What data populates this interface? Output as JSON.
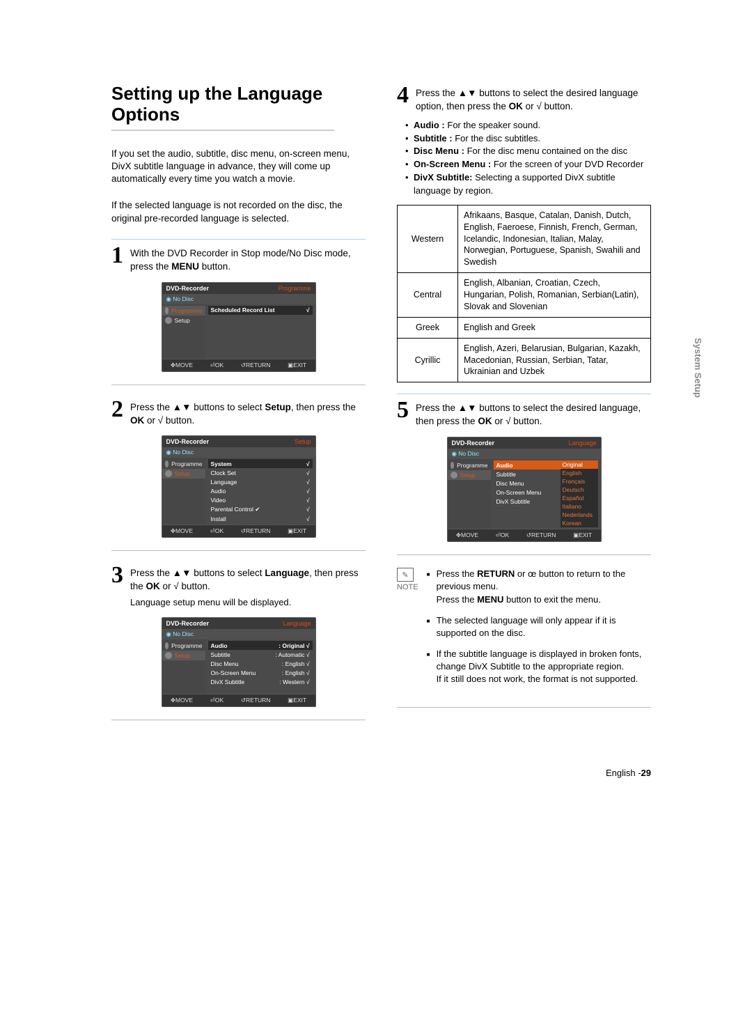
{
  "heading": "Setting up the Language Options",
  "intro1": "If you set the audio, subtitle, disc menu, on-screen menu, DivX subtitle language in advance, they will come up automatically every time you watch a movie.",
  "intro2": "If the selected language is not recorded on the disc, the original pre-recorded language is selected.",
  "step1": {
    "n": "1",
    "text": "With the DVD Recorder in Stop mode/No Disc mode, press the ",
    "b": "MENU",
    "tail": " button."
  },
  "step2": {
    "n": "2",
    "text": "Press the ▲▼ buttons to select ",
    "b": "Setup",
    "mid": ", then press the ",
    "b2": "OK",
    "tail": " or √ button."
  },
  "step3": {
    "n": "3",
    "text": "Press the ▲▼ buttons to select ",
    "b": "Language",
    "mid": ", then press the ",
    "b2": "OK",
    "tail": " or √ button.",
    "sub": "Language setup menu will be displayed."
  },
  "step4": {
    "n": "4",
    "text": "Press the ▲▼ buttons to select the desired language option, then press the ",
    "b": "OK",
    "tail": " or √ button."
  },
  "step4_bullets": [
    {
      "t": "Audio :",
      "d": " For the speaker sound."
    },
    {
      "t": "Subtitle :",
      "d": " For the disc subtitles."
    },
    {
      "t": "Disc Menu :",
      "d": " For the disc menu contained on the disc"
    },
    {
      "t": "On-Screen Menu :",
      "d": " For the screen of your DVD Recorder"
    },
    {
      "t": "DivX Subtitle:",
      "d": " Selecting a supported DivX subtitle language by region."
    }
  ],
  "langtable": [
    {
      "r": "Western",
      "v": "Afrikaans, Basque, Catalan, Danish, Dutch, English, Faeroese, Finnish, French, German, Icelandic, Indonesian, Italian, Malay, Norwegian, Portuguese, Spanish, Swahili and Swedish"
    },
    {
      "r": "Central",
      "v": "English, Albanian, Croatian, Czech, Hungarian, Polish, Romanian, Serbian(Latin), Slovak and Slovenian"
    },
    {
      "r": "Greek",
      "v": "English and Greek"
    },
    {
      "r": "Cyrillic",
      "v": "English, Azeri, Belarusian, Bulgarian, Kazakh, Macedonian, Russian, Serbian, Tatar, Ukrainian and Uzbek"
    }
  ],
  "step5": {
    "n": "5",
    "text": "Press the ▲▼ buttons to select the desired language, then press the ",
    "b": "OK",
    "tail": " or √ button."
  },
  "notes": [
    "Press the RETURN or œ button to return to the previous menu.\nPress the MENU button to exit the menu.",
    "The selected language will only appear if it is supported on the disc.",
    "If the subtitle language is displayed in broken fonts, change DivX Subtitle to the appropriate region.\nIf it still does not work, the format is not supported."
  ],
  "note_label": "NOTE",
  "sidetab": "System Setup",
  "footer_lang": "English -",
  "footer_page": "29",
  "osd": {
    "title": "DVD-Recorder",
    "nodisc": "No Disc",
    "sections": {
      "prog": "Programme",
      "setup": "Setup",
      "lang": "Language"
    },
    "side_prog": "Programme",
    "side_setup": "Setup",
    "foot": {
      "move": "MOVE",
      "ok": "OK",
      "ret": "RETURN",
      "exit": "EXIT"
    },
    "screen1_item": "Scheduled Record List",
    "screen2_items": [
      "System",
      "Clock Set",
      "Language",
      "Audio",
      "Video",
      "Parental Control ✔",
      "Install"
    ],
    "screen3_items": [
      {
        "l": "Audio",
        "v": ": Original"
      },
      {
        "l": "Subtitle",
        "v": ": Automatic"
      },
      {
        "l": "Disc Menu",
        "v": ": English"
      },
      {
        "l": "On-Screen Menu",
        "v": ": English"
      },
      {
        "l": "DivX Subtitle",
        "v": ": Western"
      }
    ],
    "screen5_left": [
      "Audio",
      "Subtitle",
      "Disc Menu",
      "On-Screen Menu",
      "DivX Subtitle"
    ],
    "screen5_langs": [
      "Original",
      "English",
      "Français",
      "Deutsch",
      "Español",
      "Italiano",
      "Nederlands",
      "Korean"
    ]
  }
}
